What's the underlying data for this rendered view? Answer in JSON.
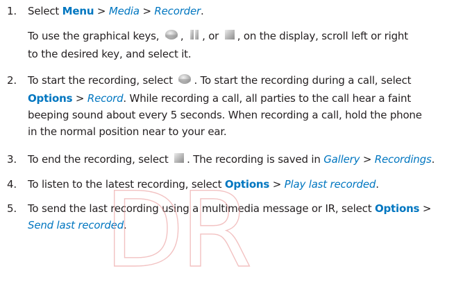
{
  "watermark": "DR",
  "steps": [
    {
      "number": "1.",
      "main": {
        "t1": "Select ",
        "b1": "Menu",
        "s1": " > ",
        "i1": "Media",
        "s2": " > ",
        "i2": "Recorder",
        "end": "."
      },
      "note": {
        "t1": "To use the graphical keys, ",
        "c1": ", ",
        "c2": ", or ",
        "c3": ", on the display, scroll left or right",
        "t2": "to the desired key, and select it."
      }
    },
    {
      "number": "2.",
      "t1": "To start the recording, select ",
      "t2": ". To start the recording during a call, select",
      "b1": "Options",
      "s1": " > ",
      "i1": "Record",
      "t3": ". While recording a call, all parties to the call hear a faint",
      "t4": "beeping sound about every 5 seconds. When recording a call, hold the phone",
      "t5": "in the normal position near to your ear."
    },
    {
      "number": "3.",
      "t1": "To end the recording, select ",
      "t2": ". The recording is saved in ",
      "i1": "Gallery",
      "s1": " > ",
      "i2": "Recordings",
      "end": "."
    },
    {
      "number": "4.",
      "t1": "To listen to the latest recording, select ",
      "b1": "Options",
      "s1": " > ",
      "i1": "Play last recorded",
      "end": "."
    },
    {
      "number": "5.",
      "t1": "To send the last recording using a multimedia message or IR, select ",
      "b1": "Options",
      "s1": " >",
      "i1": "Send last recorded",
      "end": "."
    }
  ],
  "icons": {
    "record": "record-key-icon",
    "pause": "pause-key-icon",
    "stop": "stop-key-icon"
  }
}
